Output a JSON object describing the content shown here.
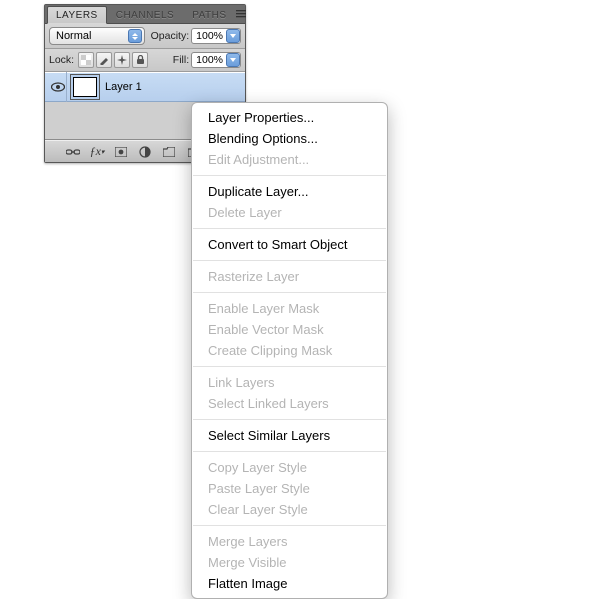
{
  "tabs": {
    "layers": "LAYERS",
    "channels": "CHANNELS",
    "paths": "PATHS"
  },
  "blendMode": "Normal",
  "opacityLabel": "Opacity:",
  "opacityValue": "100%",
  "lockLabel": "Lock:",
  "fillLabel": "Fill:",
  "fillValue": "100%",
  "layerName": "Layer 1",
  "menu": {
    "layerProps": "Layer Properties...",
    "blendOpts": "Blending Options...",
    "editAdj": "Edit Adjustment...",
    "dup": "Duplicate Layer...",
    "del": "Delete Layer",
    "smart": "Convert to Smart Object",
    "raster": "Rasterize Layer",
    "enLMask": "Enable Layer Mask",
    "enVMask": "Enable Vector Mask",
    "clip": "Create Clipping Mask",
    "link": "Link Layers",
    "selLinked": "Select Linked Layers",
    "selSimilar": "Select Similar Layers",
    "copyStyle": "Copy Layer Style",
    "pasteStyle": "Paste Layer Style",
    "clearStyle": "Clear Layer Style",
    "mergeLayers": "Merge Layers",
    "mergeVisible": "Merge Visible",
    "flatten": "Flatten Image"
  }
}
